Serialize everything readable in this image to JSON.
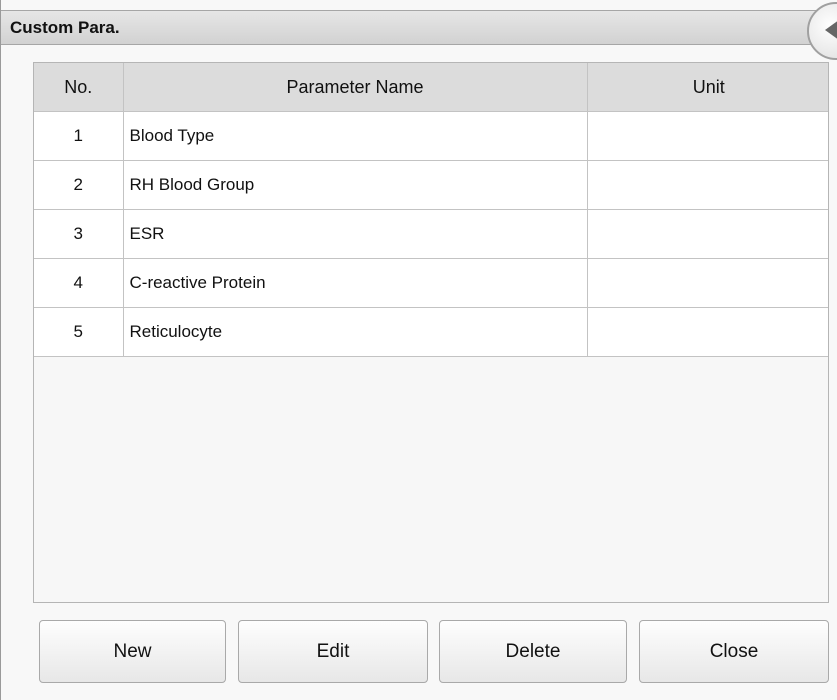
{
  "window": {
    "title": "Custom Para."
  },
  "table": {
    "headers": [
      "No.",
      "Parameter Name",
      "Unit"
    ],
    "rows": [
      {
        "no": "1",
        "name": "Blood Type",
        "unit": ""
      },
      {
        "no": "2",
        "name": "RH Blood Group",
        "unit": ""
      },
      {
        "no": "3",
        "name": "ESR",
        "unit": ""
      },
      {
        "no": "4",
        "name": "C-reactive Protein",
        "unit": ""
      },
      {
        "no": "5",
        "name": "Reticulocyte",
        "unit": ""
      }
    ]
  },
  "buttons": {
    "new_label": "New",
    "edit_label": "Edit",
    "delete_label": "Delete",
    "close_label": "Close"
  },
  "colors": {
    "titlebar": "#d8d8d8",
    "header": "#dcdcdc",
    "background": "#f8f8f8"
  },
  "icons": {
    "window_close": "close-circle-icon"
  }
}
